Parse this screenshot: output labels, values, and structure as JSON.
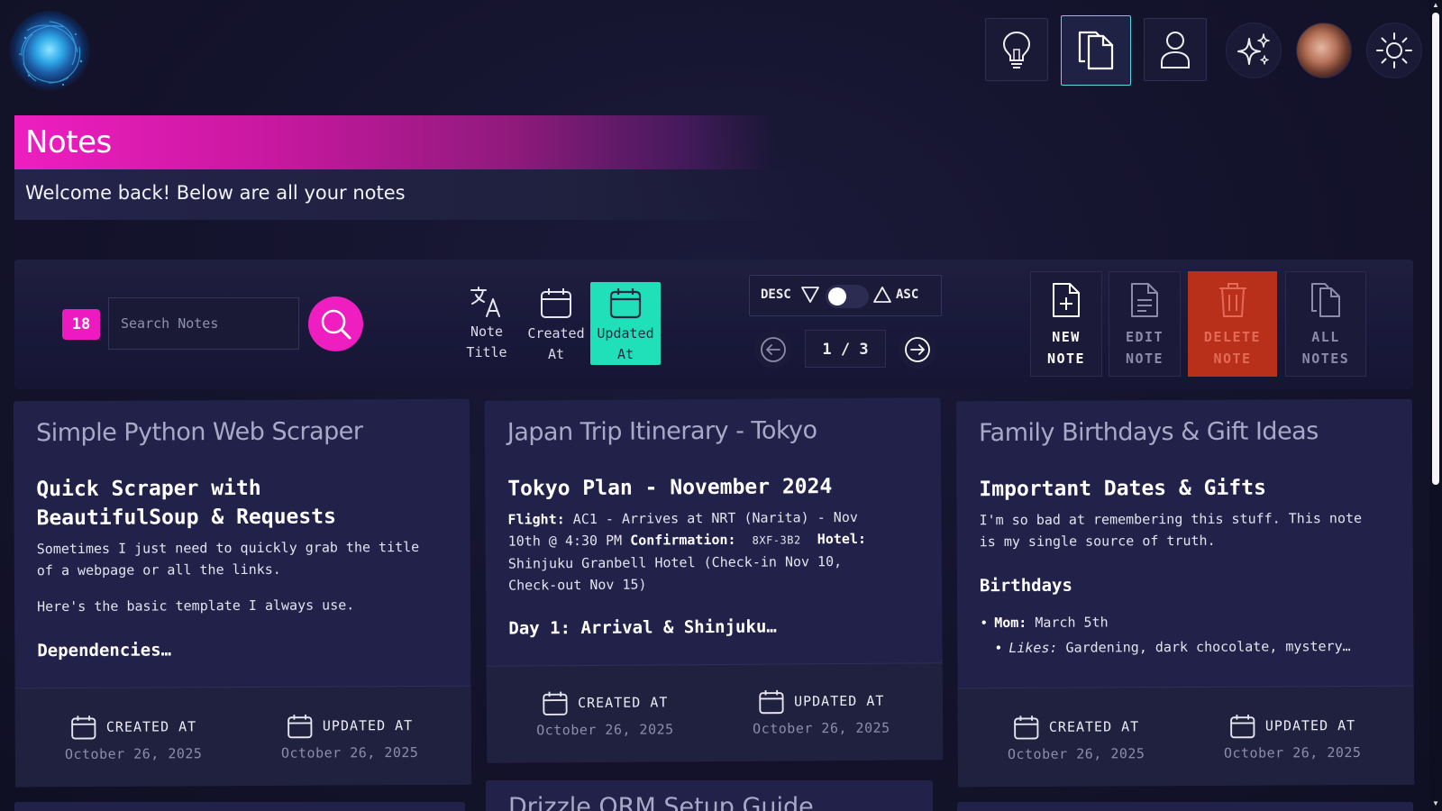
{
  "nav": {
    "items": [
      {
        "name": "ideas",
        "icon": "lightbulb-icon"
      },
      {
        "name": "notes",
        "icon": "documents-icon",
        "active": true
      },
      {
        "name": "profile",
        "icon": "user-icon"
      },
      {
        "name": "ai",
        "icon": "sparkles-icon"
      },
      {
        "name": "avatar",
        "icon": "avatar"
      },
      {
        "name": "theme",
        "icon": "sun-icon"
      }
    ]
  },
  "header": {
    "title": "Notes",
    "welcome": "Welcome back! Below are all your notes"
  },
  "toolbar": {
    "count": "18",
    "search_placeholder": "Search Notes",
    "sort_options": [
      {
        "line1": "Note",
        "line2": "Title",
        "icon": "translate-icon"
      },
      {
        "line1": "Created",
        "line2": "At",
        "icon": "calendar-icon"
      },
      {
        "line1": "Updated",
        "line2": "At",
        "icon": "calendar-icon",
        "active": true
      }
    ],
    "order": {
      "desc": "DESC",
      "asc": "ASC",
      "selected": "DESC"
    },
    "pagination": {
      "text": "1 / 3",
      "current": 1,
      "total": 3
    },
    "actions": [
      {
        "line1": "NEW",
        "line2": "NOTE",
        "icon": "new-file-icon"
      },
      {
        "line1": "EDIT",
        "line2": "NOTE",
        "icon": "edit-file-icon"
      },
      {
        "line1": "DELETE",
        "line2": "NOTE",
        "icon": "trash-icon"
      },
      {
        "line1": "ALL",
        "line2": "NOTES",
        "icon": "files-icon"
      }
    ]
  },
  "notes": [
    {
      "title": "Simple Python Web Scraper",
      "heading_line1": "Quick Scraper with",
      "heading_line2": "BeautifulSoup & Requests",
      "para1_line1": "Sometimes I just need to quickly grab the title",
      "para1_line2": "of a webpage or all the links.",
      "para2": "Here's the basic template I always use.",
      "subheading": "Dependencies…",
      "created_label": "CREATED AT",
      "created_date": "October 26, 2025",
      "updated_label": "UPDATED AT",
      "updated_date": "October 26, 2025"
    },
    {
      "title": "Japan Trip Itinerary - Tokyo",
      "heading": "Tokyo Plan - November 2024",
      "flight_label": "Flight:",
      "flight_text_line1": "AC1 - Arrives at NRT (Narita) - Nov",
      "flight_text_line2": "10th @ 4:30 PM",
      "confirmation_label": "Confirmation:",
      "confirmation_code": "8XF-3B2",
      "hotel_label": "Hotel:",
      "hotel_line1": "Shinjuku Granbell Hotel (Check-in Nov 10,",
      "hotel_line2": "Check-out Nov 15)",
      "subheading": "Day 1: Arrival & Shinjuku…",
      "created_label": "CREATED AT",
      "created_date": "October 26, 2025",
      "updated_label": "UPDATED AT",
      "updated_date": "October 26, 2025"
    },
    {
      "title": "Family Birthdays & Gift Ideas",
      "heading": "Important Dates & Gifts",
      "para_line1": "I'm so bad at remembering this stuff. This note",
      "para_line2": "is my single source of truth.",
      "subheading": "Birthdays",
      "mom_label": "Mom:",
      "mom_date": "March 5th",
      "likes_label": "Likes:",
      "likes_text": "Gardening, dark chocolate, mystery…",
      "created_label": "CREATED AT",
      "created_date": "October 26, 2025",
      "updated_label": "UPDATED AT",
      "updated_date": "October 26, 2025"
    }
  ],
  "next_row_peek": {
    "title": "Drizzle ORM Setup Guide"
  },
  "colors": {
    "accent_pink": "#ee1ec0",
    "accent_teal": "#1fe0b8",
    "danger": "#b8301a",
    "background": "#14132c",
    "card": "#22214a"
  }
}
